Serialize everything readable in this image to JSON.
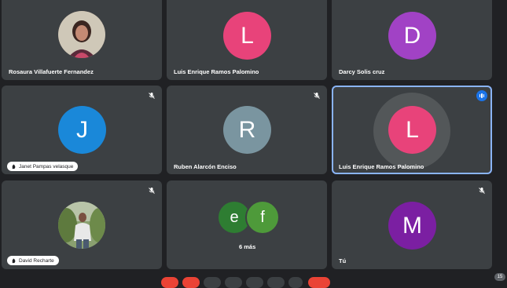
{
  "participants": [
    {
      "name": "Rosaura Villafuerte Fernandez",
      "type": "photo"
    },
    {
      "name": "Luis Enrique Ramos Palomino",
      "initial": "L",
      "color": "#e8437a"
    },
    {
      "name": "Darcy Solis cruz",
      "initial": "D",
      "color": "#a142c5"
    },
    {
      "name": "Janet Pampas velasque",
      "initial": "J",
      "color": "#1a88d9",
      "muted": true,
      "hand_raised": true
    },
    {
      "name": "Ruben Alarcón Enciso",
      "initial": "R",
      "color": "#7a95a0",
      "muted": true
    },
    {
      "name": "Luis Enrique Ramos Palomino",
      "initial": "L",
      "color": "#e8437a",
      "muted": true,
      "speaking": true
    },
    {
      "name": "David Recharte",
      "type": "photo",
      "muted": true,
      "hand_raised": true
    },
    {
      "others": [
        "e",
        "f"
      ],
      "others_colors": [
        "#2e7d32",
        "#4e9a3a"
      ],
      "label": "6 más"
    },
    {
      "name": "Tú",
      "initial": "M",
      "color": "#7b1fa2",
      "muted": true
    }
  ],
  "badge_count": "15",
  "colors": {
    "background": "#202124",
    "tile": "#3c4043",
    "active_border": "#8ab4f8",
    "end_call": "#ea4335"
  }
}
